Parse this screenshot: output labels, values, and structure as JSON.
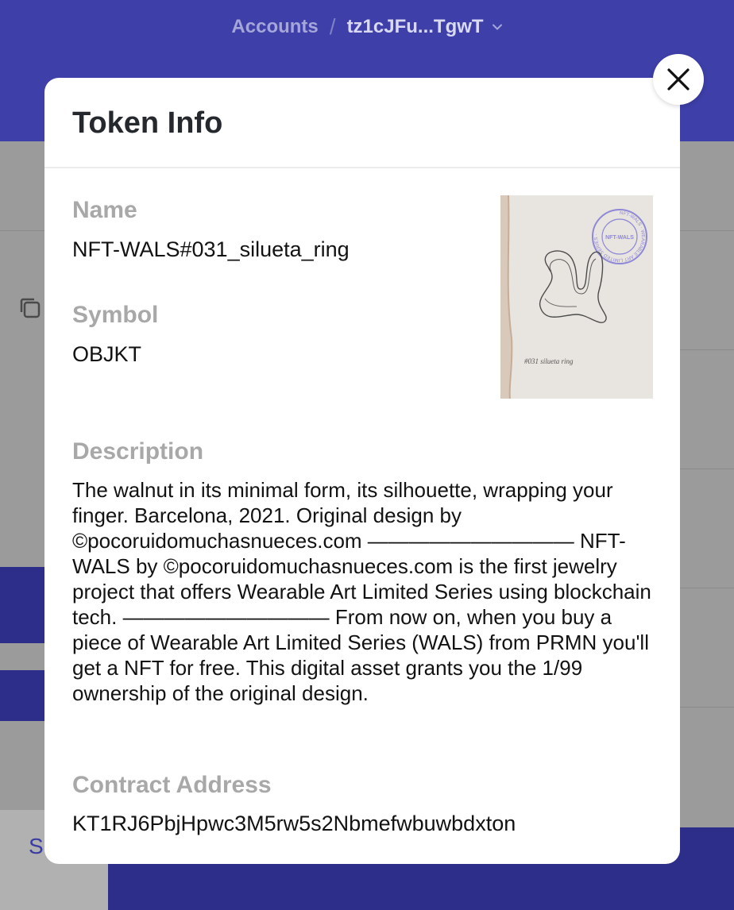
{
  "breadcrumb": {
    "root": "Accounts",
    "separator": "/",
    "account": "tz1cJFu...TgwT"
  },
  "background": {
    "partial_button_text": "S"
  },
  "modal": {
    "title": "Token Info",
    "fields": {
      "name_label": "Name",
      "name_value": "NFT-WALS#031_silueta_ring",
      "symbol_label": "Symbol",
      "symbol_value": "OBJKT",
      "description_label": "Description",
      "description_value": "The walnut in its minimal form, its silhouette, wrapping your finger. Barcelona, 2021. Original design by ©pocoruidomuchasnueces.com —————————— NFT-WALS by ©pocoruidomuchasnueces.com is the first jewelry project that offers Wearable Art Limited Series using blockchain tech. —————————— From now on, when you buy a piece of Wearable Art Limited Series (WALS) from PRMN you'll get a NFT for free. This digital asset grants you the 1/99 ownership of the original design.",
      "contract_label": "Contract Address",
      "contract_value": "KT1RJ6PbjHpwc3M5rw5s2Nbmefwbuwbdxton"
    },
    "thumbnail": {
      "stamp_text": "NFT-WALS · WEARABLE ART LIMITED SERIES ·",
      "stamp_center": "NFT-WALS",
      "caption": "#031 silueta ring"
    }
  },
  "colors": {
    "brand": "#3e3fa8",
    "label_grey": "#a8a8a8",
    "text": "#121212"
  },
  "icons": {
    "close": "close-icon",
    "chevron": "chevron-down-icon",
    "copy": "copy-icon"
  }
}
